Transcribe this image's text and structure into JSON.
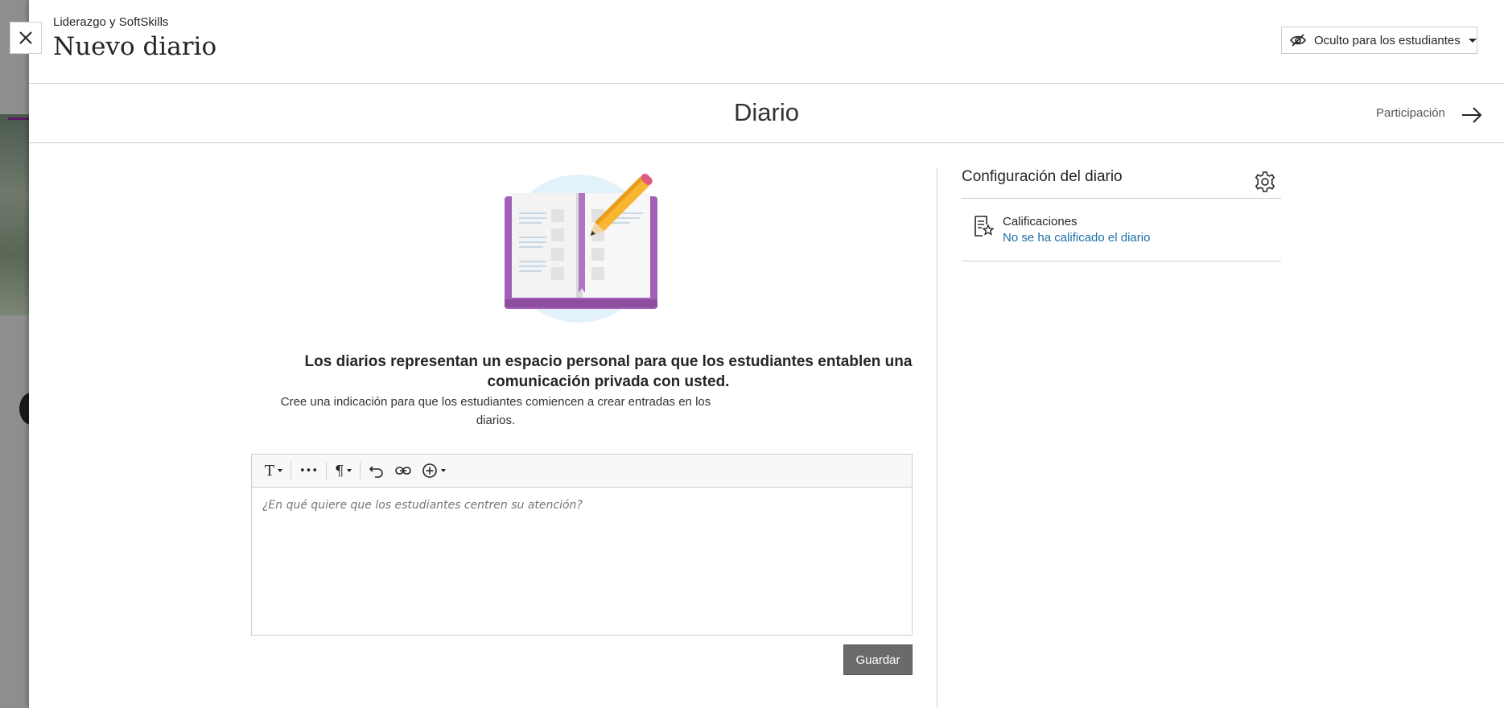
{
  "header": {
    "breadcrumb": "Liderazgo y SoftSkills",
    "title": "Nuevo diario",
    "visibility_label": "Oculto para los estudiantes"
  },
  "subheader": {
    "title": "Diario",
    "next_label": "Participación"
  },
  "intro": {
    "heading": "Los diarios representan un espacio personal para que los estudiantes entablen una comunicación privada con usted.",
    "subtext": "Cree una indicación para que los estudiantes comiencen a crear entradas en los diarios."
  },
  "editor": {
    "placeholder": "¿En qué quiere que los estudiantes centren su atención?",
    "toolbar": {
      "text_style_glyph": "T",
      "more_glyph": "•••",
      "paragraph_glyph": "¶"
    }
  },
  "save_label": "Guardar",
  "settings": {
    "title": "Configuración del diario",
    "grades_label": "Calificaciones",
    "grades_value": "No se ha calificado el diario"
  },
  "icons": {
    "close": "close-icon",
    "visibility": "eye-slash-icon",
    "next": "arrow-right-icon",
    "settings": "gear-icon",
    "grades": "gradebook-icon"
  },
  "colors": {
    "link": "#1c6fa8",
    "save_button": "#6a6a6a",
    "illustration_purple": "#a35fb5"
  }
}
